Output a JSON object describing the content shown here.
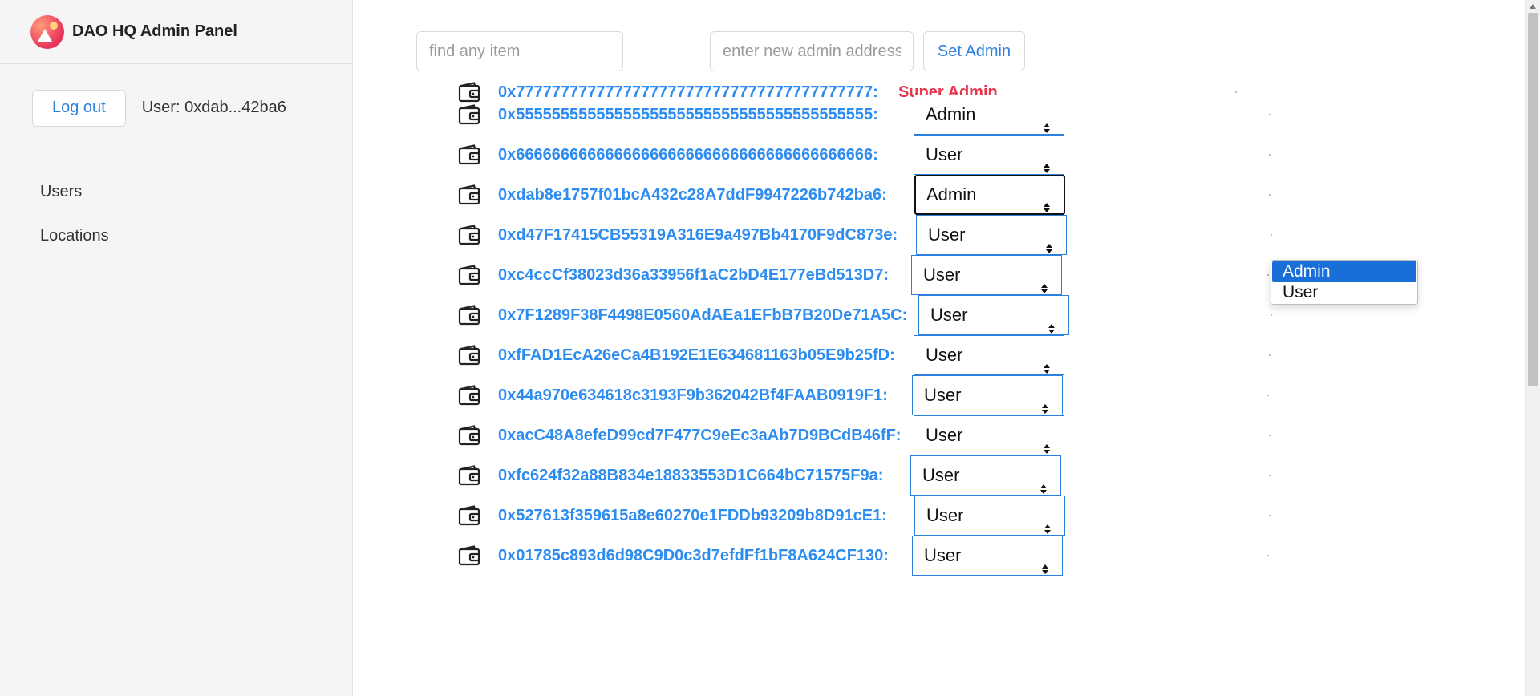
{
  "app": {
    "title": "DAO HQ Admin Panel"
  },
  "session": {
    "logout_label": "Log out",
    "user_label": "User: 0xdab...42ba6"
  },
  "nav": {
    "items": [
      {
        "label": "Users"
      },
      {
        "label": "Locations"
      }
    ]
  },
  "toolbar": {
    "search_placeholder": "find any item",
    "admin_placeholder": "enter new admin address",
    "set_admin_label": "Set Admin"
  },
  "users": {
    "super_admin": {
      "address": "0x7777777777777777777777777777777777777777:",
      "tag": "Super Admin"
    },
    "rows": [
      {
        "address": "0x5555555555555555555555555555555555555555:",
        "role": "Admin"
      },
      {
        "address": "0x6666666666666666666666666666666666666666:",
        "role": "User"
      },
      {
        "address": "0xdab8e1757f01bcA432c28A7ddF9947226b742ba6:",
        "role": "Admin"
      },
      {
        "address": "0xd47F17415CB55319A316E9a497Bb4170F9dC873e:",
        "role": "User"
      },
      {
        "address": "0xc4ccCf38023d36a33956f1aC2bD4E177eBd513D7:",
        "role": "User"
      },
      {
        "address": "0x7F1289F38F4498E0560AdAEa1EFbB7B20De71A5C:",
        "role": "User"
      },
      {
        "address": "0xfFAD1EcA26eCa4B192E1E634681163b05E9b25fD:",
        "role": "User"
      },
      {
        "address": "0x44a970e634618c3193F9b362042Bf4FAAB0919F1:",
        "role": "User"
      },
      {
        "address": "0xacC48A8efeD99cd7F477C9eEc3aAb7D9BCdB46fF:",
        "role": "User"
      },
      {
        "address": "0xfc624f32a88B834e18833553D1C664bC71575F9a:",
        "role": "User"
      },
      {
        "address": "0x527613f359615a8e60270e1FDDb93209b8D91cE1:",
        "role": "User"
      },
      {
        "address": "0x01785c893d6d98C9D0c3d7efdFf1bF8A624CF130:",
        "role": "User"
      }
    ]
  },
  "role_dropdown": {
    "options": [
      "Admin",
      "User"
    ],
    "highlighted": "Admin"
  },
  "colors": {
    "accent": "#2d8cf0",
    "super_admin": "#e8354a",
    "selected_option": "#1a6ed8"
  },
  "icons": {
    "wallet": "wallet-icon",
    "select_arrows": "sort-arrows-icon"
  }
}
